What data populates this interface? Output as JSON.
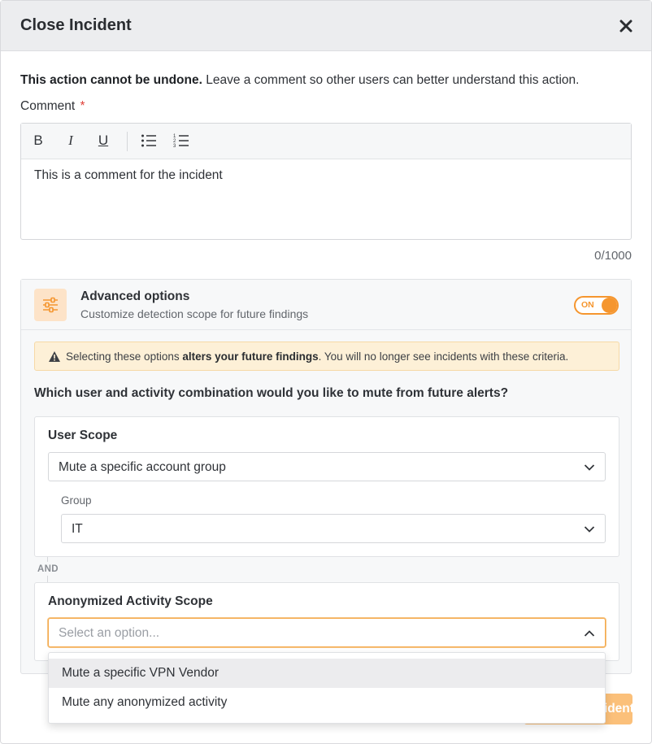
{
  "modal": {
    "title": "Close Incident",
    "close_icon": "close-x-icon"
  },
  "intro": {
    "bold": "This action cannot be undone.",
    "rest": " Leave a comment so other users can better understand this action."
  },
  "comment": {
    "label": "Comment",
    "required_mark": "*",
    "toolbar": {
      "bold": "B",
      "italic": "I",
      "underline": "U",
      "bullet_list_icon": "bulleted-list-icon",
      "numbered_list_icon": "numbered-list-icon"
    },
    "value": "This is a comment for the incident",
    "counter": "0/1000"
  },
  "advanced": {
    "icon": "sliders-icon",
    "title": "Advanced options",
    "subtitle": "Customize detection scope for future findings",
    "toggle_label": "ON",
    "toggle_on": true,
    "warning": {
      "icon": "warning-triangle-icon",
      "prefix": "Selecting these options ",
      "bold": "alters your future findings",
      "suffix": ". You will no longer see incidents with these criteria."
    },
    "question": "Which user and activity combination would you like to mute from future alerts?",
    "user_scope": {
      "title": "User Scope",
      "selected": "Mute a specific account group",
      "group_label": "Group",
      "group_value": "IT"
    },
    "connector": "AND",
    "activity_scope": {
      "title": "Anonymized Activity Scope",
      "placeholder": "Select an option...",
      "options": [
        "Mute a specific VPN Vendor",
        "Mute any anonymized activity"
      ],
      "highlighted_index": 0
    }
  },
  "footer": {
    "submit_label": "Close Incident"
  },
  "colors": {
    "accent": "#f5962f",
    "accent_light": "#fde3c8",
    "warning_bg": "#fdf0d7",
    "required": "#e0413a"
  }
}
